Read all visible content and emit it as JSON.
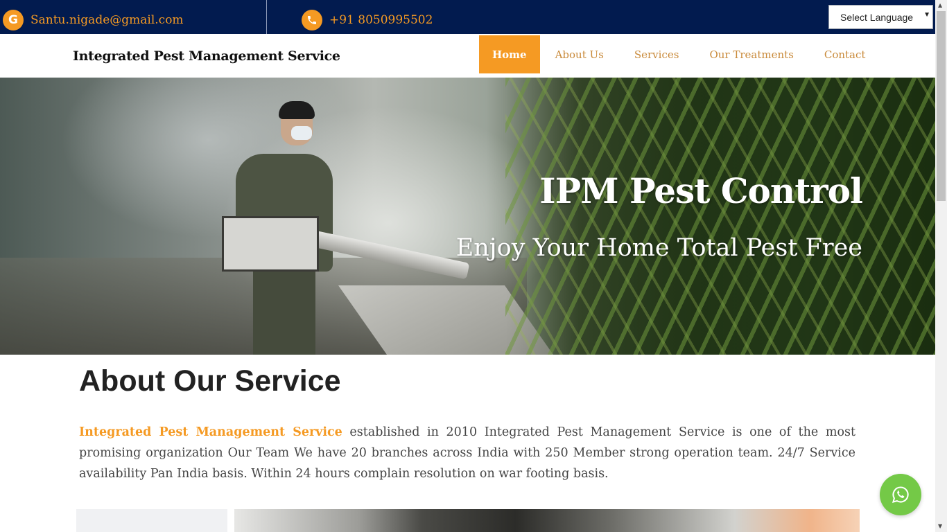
{
  "topbar": {
    "email": "Santu.nigade@gmail.com",
    "email_icon": "google-icon",
    "email_icon_glyph": "G",
    "phone": "+91 8050995502",
    "phone_icon": "phone-icon",
    "language_select": "Select Language",
    "background_color": "#021b4f",
    "accent_color": "#f59a23"
  },
  "header": {
    "brand": "Integrated Pest Management Service",
    "nav": [
      {
        "label": "Home",
        "active": true
      },
      {
        "label": "About Us",
        "active": false
      },
      {
        "label": "Services",
        "active": false
      },
      {
        "label": "Our Treatments",
        "active": false
      },
      {
        "label": "Contact",
        "active": false
      }
    ]
  },
  "hero": {
    "title": "IPM Pest Control",
    "subtitle": "Enjoy Your Home Total Pest Free"
  },
  "about": {
    "title": "About Our Service",
    "highlight": "Integrated Pest Management Service",
    "body": " established in 2010 Integrated Pest Management Service is one of the most promising organization Our Team We have 20 branches across India with 250 Member strong operation team. 24/7 Service availability Pan India basis. Within 24 hours complain resolution on war footing basis."
  },
  "floating": {
    "whatsapp_icon": "whatsapp-icon",
    "whatsapp_color": "#74c947"
  }
}
